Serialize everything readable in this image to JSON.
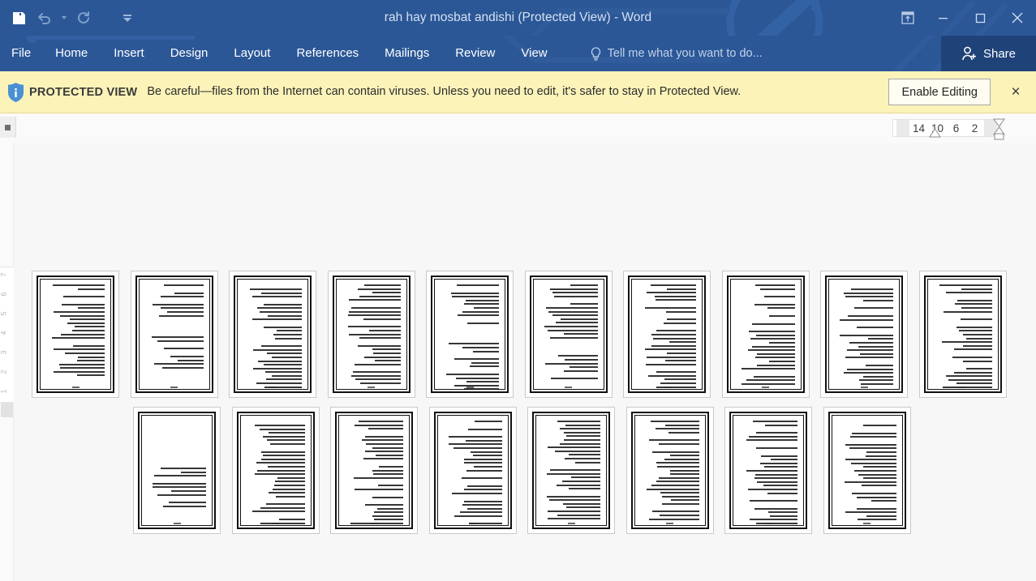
{
  "window": {
    "title": "rah hay mosbat andishi (Protected View) - Word",
    "app_name": "Word",
    "document_name": "rah hay mosbat andishi",
    "mode": "Protected View",
    "accent_color": "#2b5797",
    "share_accent_color": "#1f4278"
  },
  "quick_access": {
    "items": [
      {
        "name": "save-button",
        "icon": "save-icon",
        "label": "Save",
        "enabled": true
      },
      {
        "name": "undo-button",
        "icon": "undo-icon",
        "label": "Undo",
        "enabled": false
      },
      {
        "name": "redo-button",
        "icon": "redo-icon",
        "label": "Repeat",
        "enabled": false
      },
      {
        "name": "customize-qat-button",
        "icon": "chevron-down-icon",
        "label": "Customize Quick Access Toolbar",
        "enabled": true
      }
    ]
  },
  "window_controls": {
    "ribbon_display_options": "Ribbon Display Options",
    "minimize": "Minimize",
    "restore": "Restore Down",
    "close": "Close"
  },
  "ribbon": {
    "tabs": [
      {
        "label": "File",
        "active": false
      },
      {
        "label": "Home",
        "active": false
      },
      {
        "label": "Insert",
        "active": false
      },
      {
        "label": "Design",
        "active": false
      },
      {
        "label": "Layout",
        "active": false
      },
      {
        "label": "References",
        "active": false
      },
      {
        "label": "Mailings",
        "active": false
      },
      {
        "label": "Review",
        "active": false
      },
      {
        "label": "View",
        "active": false
      }
    ],
    "tell_me_placeholder": "Tell me what you want to do...",
    "share_label": "Share",
    "collapsed": true
  },
  "protected_view": {
    "badge": "PROTECTED VIEW",
    "message": "Be careful—files from the Internet can contain viruses. Unless you need to edit, it's safer to stay in Protected View.",
    "enable_button": "Enable Editing",
    "close_label": "×",
    "background_color": "#fcf3b9"
  },
  "ruler": {
    "orientation": "rtl",
    "horizontal_ticks": [
      "14",
      "10",
      "6",
      "2"
    ],
    "tab_stop_selector": "left-tab-stop",
    "vertical_ticks": [
      "7",
      "6",
      "5",
      "4",
      "3",
      "2",
      "1"
    ]
  },
  "document": {
    "view_mode": "multiple-pages",
    "zoom_level": "10%",
    "direction": "rtl",
    "language": "Persian",
    "total_pages_visible": 18,
    "rows": [
      {
        "row": 1,
        "page_count": 10,
        "pages": [
          {
            "page_number": 1,
            "lines": 22,
            "layout": "full"
          },
          {
            "page_number": 2,
            "lines": 14,
            "layout": "partial-bottom-blank"
          },
          {
            "page_number": 3,
            "lines": 24,
            "layout": "full"
          },
          {
            "page_number": 4,
            "lines": 23,
            "layout": "full"
          },
          {
            "page_number": 5,
            "lines": 21,
            "layout": "partial-blank-middle"
          },
          {
            "page_number": 6,
            "lines": 20,
            "layout": "partial-blank-bottom"
          },
          {
            "page_number": 7,
            "lines": 24,
            "layout": "full"
          },
          {
            "page_number": 8,
            "lines": 25,
            "layout": "full"
          },
          {
            "page_number": 9,
            "lines": 25,
            "layout": "full"
          },
          {
            "page_number": 10,
            "lines": 24,
            "layout": "full"
          }
        ]
      },
      {
        "row": 2,
        "page_count": 8,
        "pages": [
          {
            "page_number": 11,
            "lines": 9,
            "layout": "partial-top-blank"
          },
          {
            "page_number": 12,
            "lines": 24,
            "layout": "full"
          },
          {
            "page_number": 13,
            "lines": 25,
            "layout": "full"
          },
          {
            "page_number": 14,
            "lines": 24,
            "layout": "full"
          },
          {
            "page_number": 15,
            "lines": 25,
            "layout": "full"
          },
          {
            "page_number": 16,
            "lines": 24,
            "layout": "full"
          },
          {
            "page_number": 17,
            "lines": 25,
            "layout": "full"
          },
          {
            "page_number": 18,
            "lines": 24,
            "layout": "full"
          }
        ]
      }
    ]
  },
  "colors": {
    "workspace": "#f7f7f7",
    "page": "#ffffff",
    "page_border": "#c9c9c9",
    "banner": "#fcf3b9",
    "banner_border": "#e4d98f"
  }
}
